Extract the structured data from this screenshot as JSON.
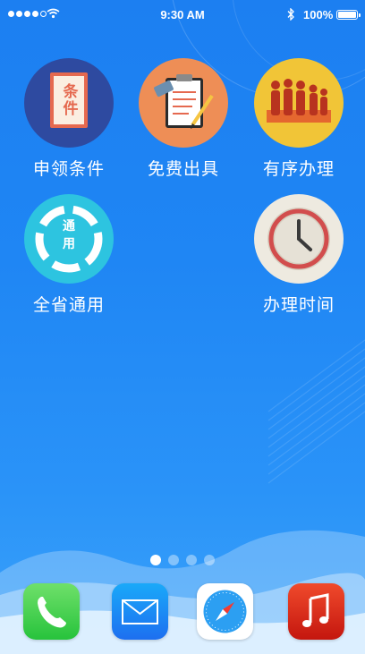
{
  "status_bar": {
    "time": "9:30 AM",
    "battery": "100%",
    "signal_bars_filled": 4,
    "signal_bars_total": 5
  },
  "apps": [
    {
      "label": "申领条件",
      "icon": "document-icon",
      "icon_text": "条件",
      "color": "#2e4aa0"
    },
    {
      "label": "免费出具",
      "icon": "clipboard-icon",
      "color": "#ee8e56"
    },
    {
      "label": "有序办理",
      "icon": "queue-icon",
      "color": "#f1c537"
    },
    {
      "label": "全省通用",
      "icon": "circular-arrows-icon",
      "icon_text": "通用",
      "color": "#2dc4e0"
    },
    {
      "label": "办理时间",
      "icon": "clock-icon",
      "color": "#eeeae0"
    }
  ],
  "page_dots": {
    "count": 4,
    "active_index": 0
  },
  "dock": [
    {
      "name": "phone",
      "icon": "phone-icon",
      "color": "#4cd662"
    },
    {
      "name": "mail",
      "icon": "mail-icon",
      "color": "#1c8ff5"
    },
    {
      "name": "safari",
      "icon": "compass-icon",
      "color": "#ffffff"
    },
    {
      "name": "music",
      "icon": "music-note-icon",
      "color": "#e52f1e"
    }
  ]
}
